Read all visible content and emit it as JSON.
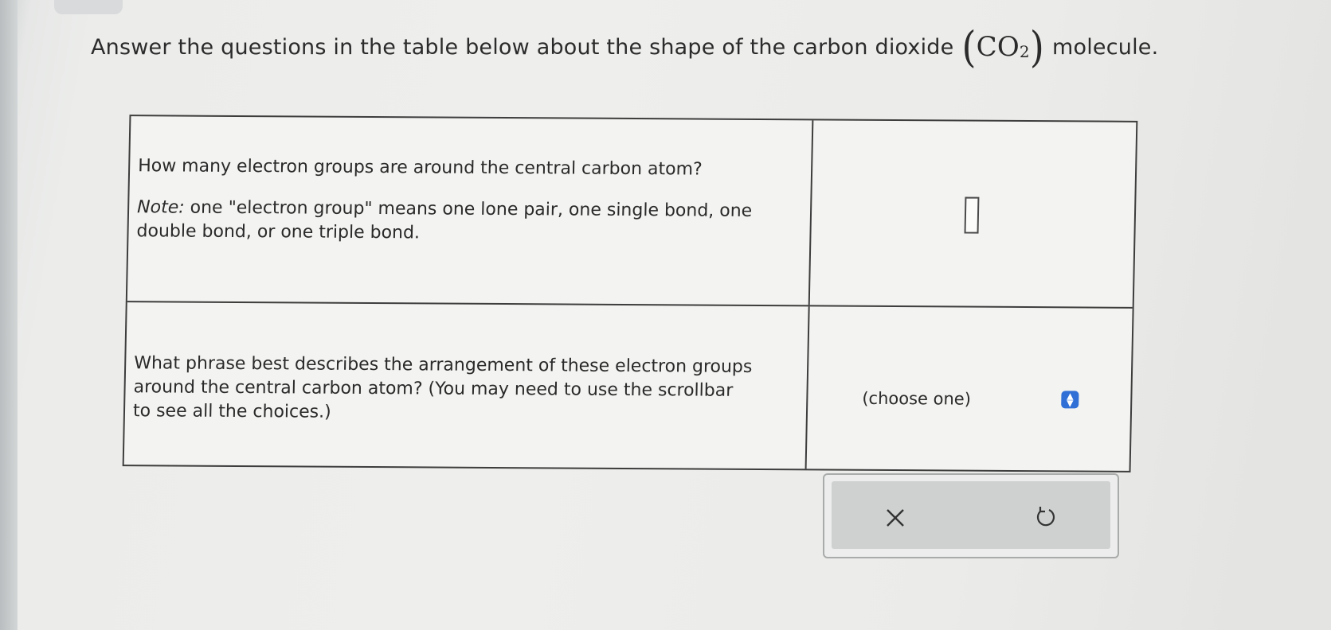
{
  "header": {
    "prefix": "Answer the questions in the table below about the shape of the carbon dioxide",
    "formula_open": "(",
    "formula_main": "CO",
    "formula_sub": "2",
    "formula_close": ")",
    "suffix": "molecule."
  },
  "table": {
    "q1": {
      "text": "How many electron groups are around the central carbon atom?",
      "note_label": "Note:",
      "note_text": "one \"electron group\" means one lone pair, one single bond, one double bond, or one triple bond.",
      "answer_value": ""
    },
    "q2": {
      "text": "What phrase best describes the arrangement of these electron groups around the central carbon atom? (You may need to use the scrollbar to see all the choices.)",
      "select_value": "(choose one)"
    }
  },
  "actions": {
    "clear_icon": "x-icon",
    "undo_icon": "undo-icon"
  },
  "colors": {
    "select_accent": "#2f6fd6"
  }
}
